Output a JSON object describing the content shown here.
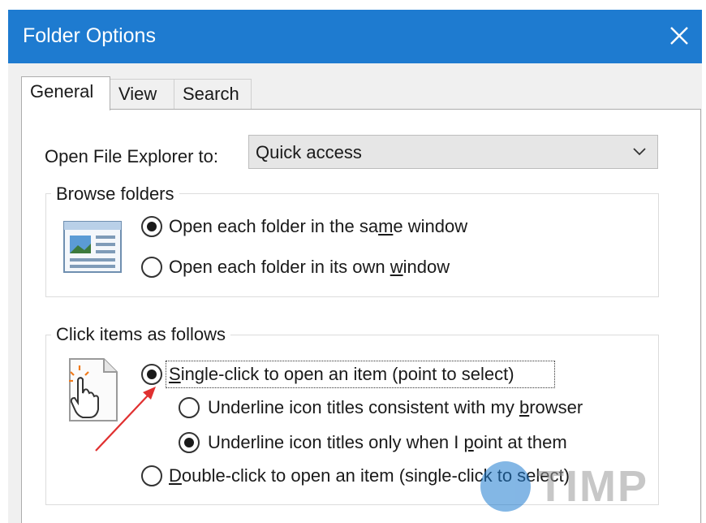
{
  "window": {
    "title": "Folder Options",
    "title_bar_color": "#1e7bd0"
  },
  "tabs": [
    {
      "label": "General",
      "active": true
    },
    {
      "label": "View",
      "active": false
    },
    {
      "label": "Search",
      "active": false
    }
  ],
  "open_explorer": {
    "label": "Open File Explorer to:",
    "selected_value": "Quick access"
  },
  "browse_folders": {
    "title": "Browse folders",
    "options": [
      {
        "pre": "Open each folder in the sa",
        "mnemonic": "m",
        "post": "e window",
        "checked": true
      },
      {
        "pre": "Open each folder in its own ",
        "mnemonic": "w",
        "post": "indow",
        "checked": false
      }
    ]
  },
  "click_items": {
    "title": "Click items as follows",
    "single_click": {
      "pre": "",
      "mnemonic": "S",
      "post": "ingle-click to open an item (point to select)",
      "checked": true
    },
    "underline_browser": {
      "pre": "Underline icon titles consistent with my ",
      "mnemonic": "b",
      "post": "rowser",
      "checked": false
    },
    "underline_point": {
      "pre": "Underline icon titles only when I ",
      "mnemonic": "p",
      "post": "oint at them",
      "checked": true
    },
    "double_click": {
      "pre": "",
      "mnemonic": "D",
      "post": "ouble-click to open an item (single-click to select)",
      "checked": false
    }
  },
  "annotation": {
    "arrow_color": "#e03030"
  },
  "watermark": {
    "text": "TIMP"
  }
}
